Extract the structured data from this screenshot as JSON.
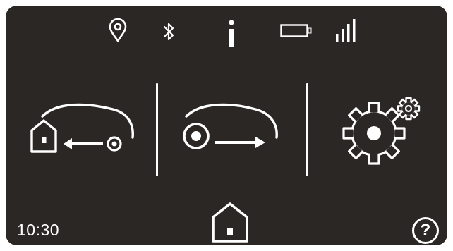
{
  "status_bar": {
    "icons": [
      "location-pin-icon",
      "bluetooth-icon",
      "info-icon",
      "battery-icon",
      "signal-strength-icon"
    ]
  },
  "main_menu": {
    "items": [
      {
        "name": "mower-park-home-button",
        "icon": "mower-return-home-icon"
      },
      {
        "name": "mower-start-button",
        "icon": "mower-drive-out-icon"
      },
      {
        "name": "settings-button",
        "icon": "settings-gears-icon"
      }
    ]
  },
  "footer": {
    "time": "10:30",
    "home_icon": "home-icon",
    "help_label": "?"
  },
  "colors": {
    "screen_background": "#2a2724",
    "foreground": "#ffffff"
  }
}
